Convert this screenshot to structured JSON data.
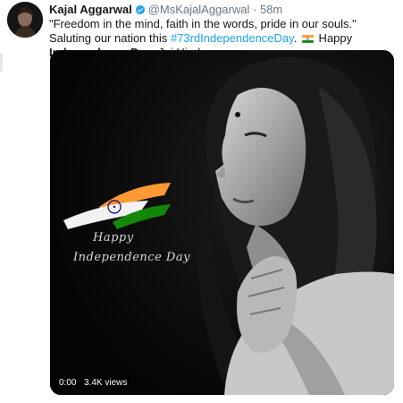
{
  "author": {
    "display_name": "Kajal Aggarwal",
    "handle": "@MsKajalAggarwal",
    "separator": "·",
    "time": "58m",
    "verified_icon": "verified-badge-icon"
  },
  "tweet": {
    "text_1": "\"Freedom in the mind, faith in the words, pride in our souls.\" Saluting our nation this ",
    "hashtag": "#73rdIndependenceDay",
    "text_2": ". ",
    "text_3": " Happy ",
    "bold": "Independence Day",
    "text_4": ". Jai Hind."
  },
  "media": {
    "overlay_line1": "Happy",
    "overlay_line2": "Independence Day",
    "timestamp": "0:00",
    "views": "3.4K views"
  },
  "colors": {
    "link": "#1da1f2",
    "verified": "#1da1f2",
    "saffron": "#ff9933",
    "green": "#138808",
    "chakra": "#000080"
  }
}
